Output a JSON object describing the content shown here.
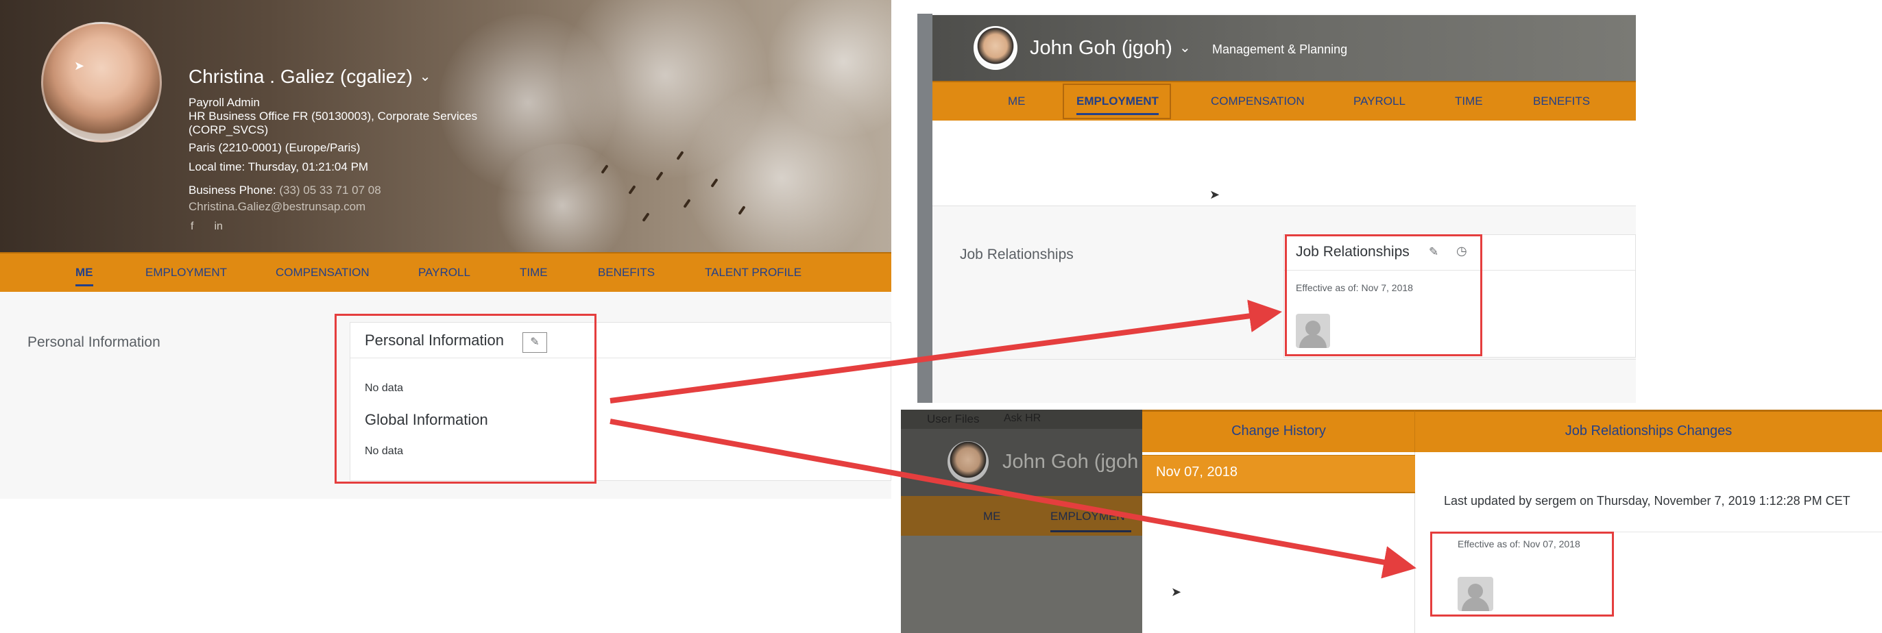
{
  "panel_christina": {
    "name": "Christina . Galiez (cgaliez)",
    "title": "Payroll Admin",
    "office_line1": "HR Business Office FR (50130003), Corporate Services",
    "office_line2": "(CORP_SVCS)",
    "location": "Paris (2210-0001) (Europe/Paris)",
    "local_time": "Local time: Thursday, 01:21:04 PM",
    "phone_label": "Business Phone:",
    "phone_value": "(33) 05 33 71 07 08",
    "email": "Christina.Galiez@bestrunsap.com",
    "social": [
      "f",
      "in"
    ],
    "tabs": [
      "ME",
      "EMPLOYMENT",
      "COMPENSATION",
      "PAYROLL",
      "TIME",
      "BENEFITS",
      "TALENT PROFILE"
    ],
    "selected_tab": "ME",
    "section_label": "Personal Information",
    "card_title": "Personal Information",
    "no_data": "No data",
    "global_title": "Global Information",
    "no_data_2": "No data"
  },
  "panel_john": {
    "name": "John Goh (jgoh)",
    "department": "Management & Planning",
    "tabs": [
      "ME",
      "EMPLOYMENT",
      "COMPENSATION",
      "PAYROLL",
      "TIME",
      "BENEFITS"
    ],
    "selected_tab": "EMPLOYMENT",
    "section_label": "Job Relationships",
    "card_title": "Job Relationships",
    "effective": "Effective as of: Nov 7, 2018"
  },
  "panel_history": {
    "top_links": [
      "User Files",
      "Ask HR"
    ],
    "bg_name": "John Goh (jgoh",
    "bg_tabs": [
      "ME",
      "EMPLOYMEN"
    ],
    "change_history_title": "Change History",
    "changes_title": "Job Relationships Changes",
    "history_date": "Nov 07, 2018",
    "last_updated": "Last updated by sergem on Thursday, November 7, 2019 1:12:28 PM CET",
    "effective": "Effective as of: Nov 07, 2018"
  },
  "icons": {
    "chevron": "chevron-down-icon",
    "edit": "pencil-icon",
    "history": "clock-icon",
    "facebook": "facebook-icon",
    "linkedin": "linkedin-icon",
    "cursor": "mouse-cursor-icon",
    "placeholder": "person-placeholder-icon"
  },
  "colors": {
    "tab_bar": "#e08a12",
    "tab_text": "#22408a",
    "highlight": "#e53e3e",
    "arrow": "#e53e3e"
  }
}
